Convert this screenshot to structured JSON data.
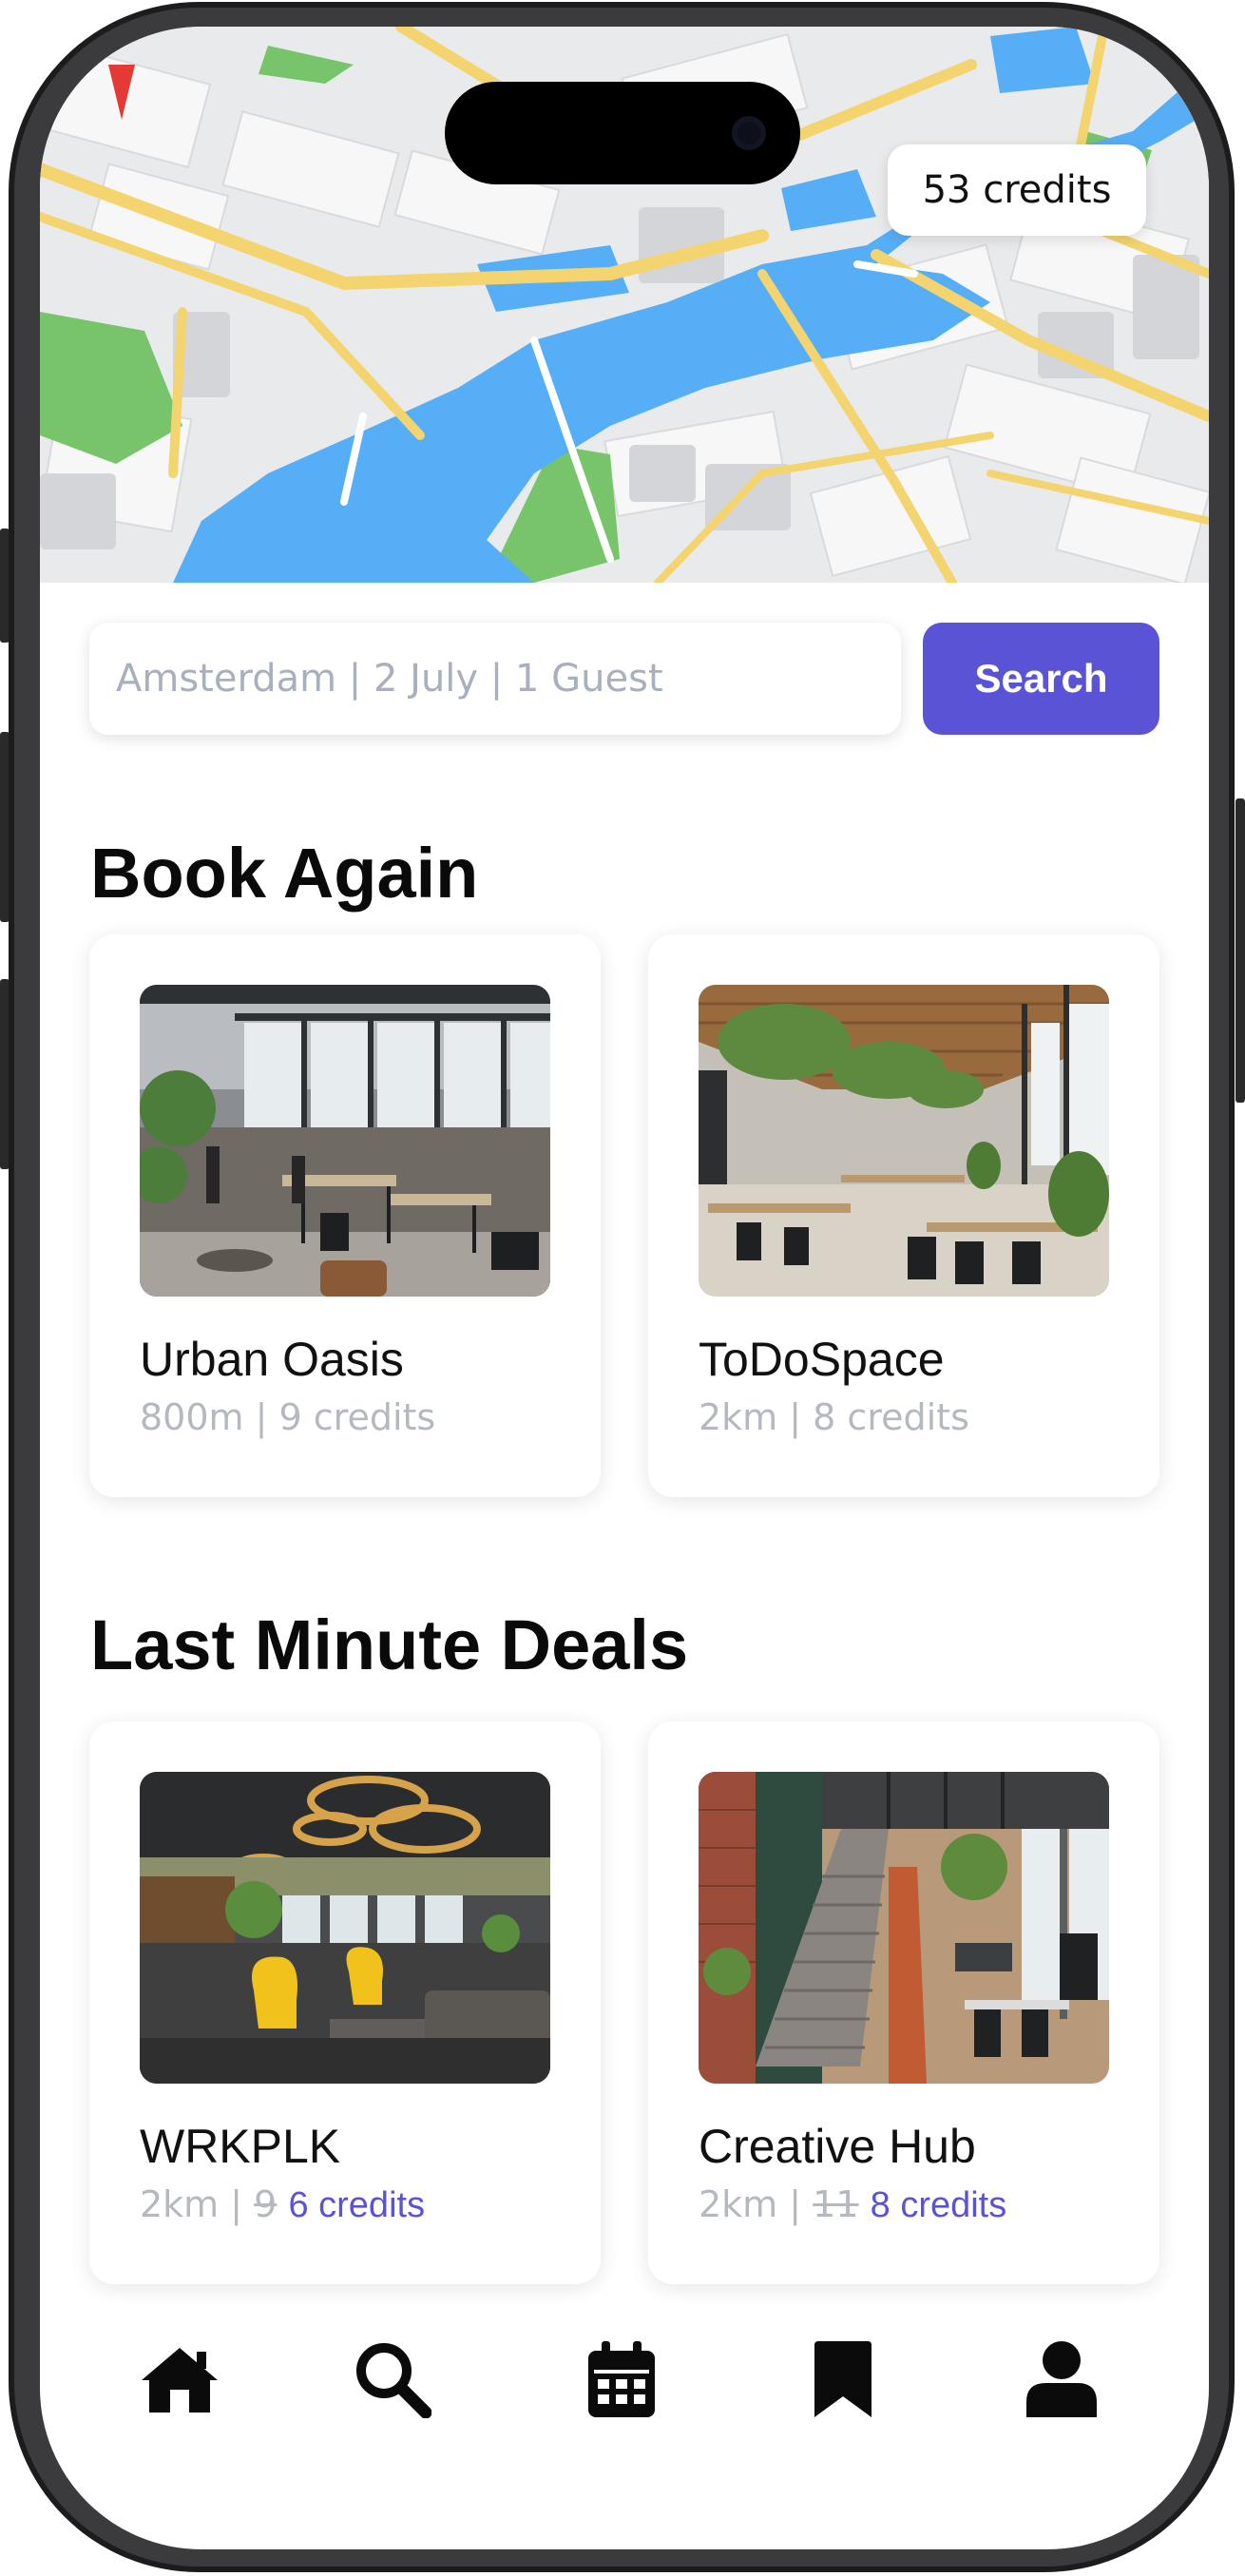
{
  "header": {
    "credits_label": "53 credits"
  },
  "search": {
    "placeholder": "Amsterdam | 2 July | 1 Guest",
    "button_label": "Search"
  },
  "book_again": {
    "title": "Book Again",
    "items": [
      {
        "name": "Urban Oasis",
        "distance": "800m",
        "sep": " | ",
        "credits": "9 credits"
      },
      {
        "name": "ToDoSpace",
        "distance": "2km",
        "sep": " | ",
        "credits": "8 credits"
      }
    ]
  },
  "last_minute": {
    "title": "Last Minute Deals",
    "items": [
      {
        "name": "WRKPLK",
        "distance": "2km",
        "sep": " | ",
        "old_price": "9",
        "new_price": "6 credits"
      },
      {
        "name": "Creative Hub",
        "distance": "2km",
        "sep": " | ",
        "old_price": "11",
        "new_price": "8 credits"
      }
    ]
  },
  "tabbar": {
    "items": [
      {
        "icon": "home-icon"
      },
      {
        "icon": "search-icon"
      },
      {
        "icon": "calendar-icon"
      },
      {
        "icon": "bookmark-icon"
      },
      {
        "icon": "profile-icon"
      }
    ]
  },
  "colors": {
    "accent": "#5b53d6",
    "water": "#56aef6",
    "park": "#77c46b",
    "road": "#f3d46f"
  }
}
